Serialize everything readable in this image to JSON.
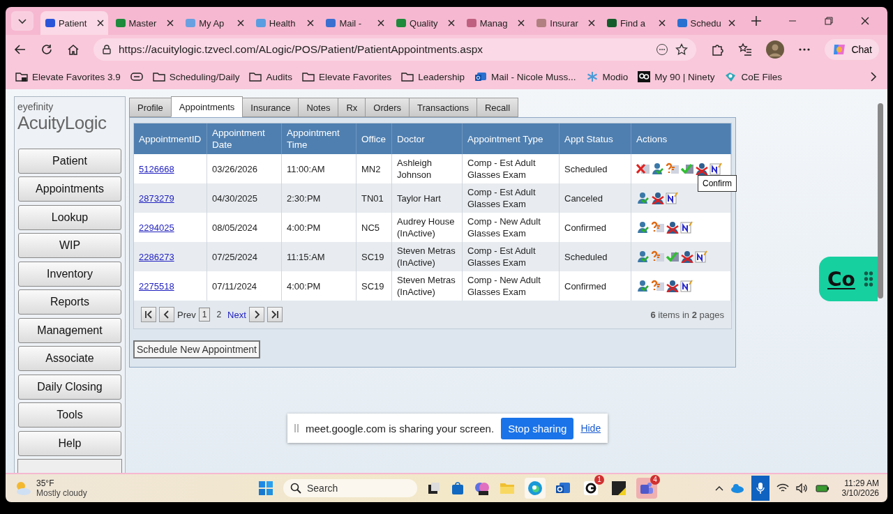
{
  "browser": {
    "tabs": [
      {
        "title": "Patient",
        "selected": true
      },
      {
        "title": "Master",
        "selected": false
      },
      {
        "title": "My Ap",
        "selected": false
      },
      {
        "title": "Health",
        "selected": false
      },
      {
        "title": "Mail - ",
        "selected": false
      },
      {
        "title": "Quality",
        "selected": false
      },
      {
        "title": "Manag",
        "selected": false
      },
      {
        "title": "Insurar",
        "selected": false
      },
      {
        "title": "Find a",
        "selected": false
      },
      {
        "title": "Schedu",
        "selected": false
      }
    ],
    "url": "https://acuitylogic.tzvecl.com/ALogic/POS/Patient/PatientAppointments.aspx",
    "chat": "Chat",
    "bookmarks": [
      {
        "label": "Elevate Favorites 3.9",
        "kind": "app"
      },
      {
        "kind": "icon"
      },
      {
        "label": "Scheduling/Daily",
        "kind": "folder"
      },
      {
        "label": "Audits",
        "kind": "folder"
      },
      {
        "label": "Elevate Favorites",
        "kind": "folder"
      },
      {
        "label": "Leadership",
        "kind": "folder"
      },
      {
        "label": "Mail - Nicole Muss...",
        "kind": "mail"
      },
      {
        "label": "Modio",
        "kind": "snow"
      },
      {
        "label": "My 90 | Ninety",
        "kind": "ninety"
      },
      {
        "label": "CoE Files",
        "kind": "files"
      }
    ]
  },
  "logo": {
    "brand": "eyefinity",
    "product": "AcuityLogic"
  },
  "nav": [
    "Patient",
    "Appointments",
    "Lookup",
    "WIP",
    "Inventory",
    "Reports",
    "Management",
    "Associate",
    "Daily Closing",
    "Tools",
    "Help"
  ],
  "tabs": [
    {
      "label": "Profile",
      "selected": false
    },
    {
      "label": "Appointments",
      "selected": true
    },
    {
      "label": "Insurance",
      "selected": false
    },
    {
      "label": "Notes",
      "selected": false
    },
    {
      "label": "Rx",
      "selected": false
    },
    {
      "label": "Orders",
      "selected": false
    },
    {
      "label": "Transactions",
      "selected": false
    },
    {
      "label": "Recall",
      "selected": false
    }
  ],
  "table": {
    "columns": [
      "AppointmentID",
      "Appointment Date",
      "Appointment Time",
      "Office",
      "Doctor",
      "Appointment Type",
      "Appt Status",
      "Actions"
    ],
    "rows": [
      {
        "id": "5126668",
        "date": "03/26/2026",
        "time": "11:00:AM",
        "office": "MN2",
        "doctor": "Ashleigh Johnson",
        "type": "Comp - Est Adult Glasses Exam",
        "status": "Scheduled",
        "actions": [
          {
            "kind": "cancel"
          },
          {
            "kind": "check_in"
          },
          {
            "kind": "reschedule"
          },
          {
            "kind": "confirm"
          },
          {
            "kind": "no_show"
          },
          {
            "kind": "note"
          }
        ]
      },
      {
        "id": "2873279",
        "date": "04/30/2025",
        "time": "2:30:PM",
        "office": "TN01",
        "doctor": "Taylor Hart",
        "type": "Comp - Est Adult Glasses Exam",
        "status": "Canceled",
        "actions": [
          {
            "kind": "check_in"
          },
          {
            "kind": "no_show"
          },
          {
            "kind": "note"
          }
        ]
      },
      {
        "id": "2294025",
        "date": "08/05/2024",
        "time": "4:00:PM",
        "office": "NC5",
        "doctor": "Audrey House (InActive)",
        "type": "Comp - New Adult Glasses Exam",
        "status": "Confirmed",
        "actions": [
          {
            "kind": "check_in"
          },
          {
            "kind": "reschedule"
          },
          {
            "kind": "no_show"
          },
          {
            "kind": "note"
          }
        ]
      },
      {
        "id": "2286273",
        "date": "07/25/2024",
        "time": "11:15:AM",
        "office": "SC19",
        "doctor": "Steven Metras (InActive)",
        "type": "Comp - Est Adult Glasses Exam",
        "status": "Scheduled",
        "actions": [
          {
            "kind": "check_in"
          },
          {
            "kind": "reschedule"
          },
          {
            "kind": "confirm"
          },
          {
            "kind": "no_show"
          },
          {
            "kind": "note"
          }
        ]
      },
      {
        "id": "2275518",
        "date": "07/11/2024",
        "time": "4:00:PM",
        "office": "SC19",
        "doctor": "Steven Metras (InActive)",
        "type": "Comp - New Adult Glasses Exam",
        "status": "Confirmed",
        "actions": [
          {
            "kind": "check_in"
          },
          {
            "kind": "reschedule"
          },
          {
            "kind": "no_show"
          },
          {
            "kind": "note"
          }
        ]
      }
    ],
    "pager": {
      "prev": "Prev",
      "pages": [
        {
          "label": "1",
          "selected": true
        },
        {
          "label": "2",
          "selected": false
        }
      ],
      "next": "Next",
      "summary": "**6** items in **2** pages"
    }
  },
  "tooltip": "Confirm",
  "schedule_button": "Schedule New Appointment",
  "widget": {
    "label": "Co"
  },
  "share_bar": {
    "message": "meet.google.com is sharing your screen.",
    "stop": "Stop sharing",
    "hide": "Hide"
  },
  "taskbar": {
    "temp": "35°F",
    "weather": "Mostly cloudy",
    "search": "Search",
    "badges": [
      "1",
      "4"
    ],
    "time": "11:29 AM",
    "date": "3/10/2026"
  }
}
